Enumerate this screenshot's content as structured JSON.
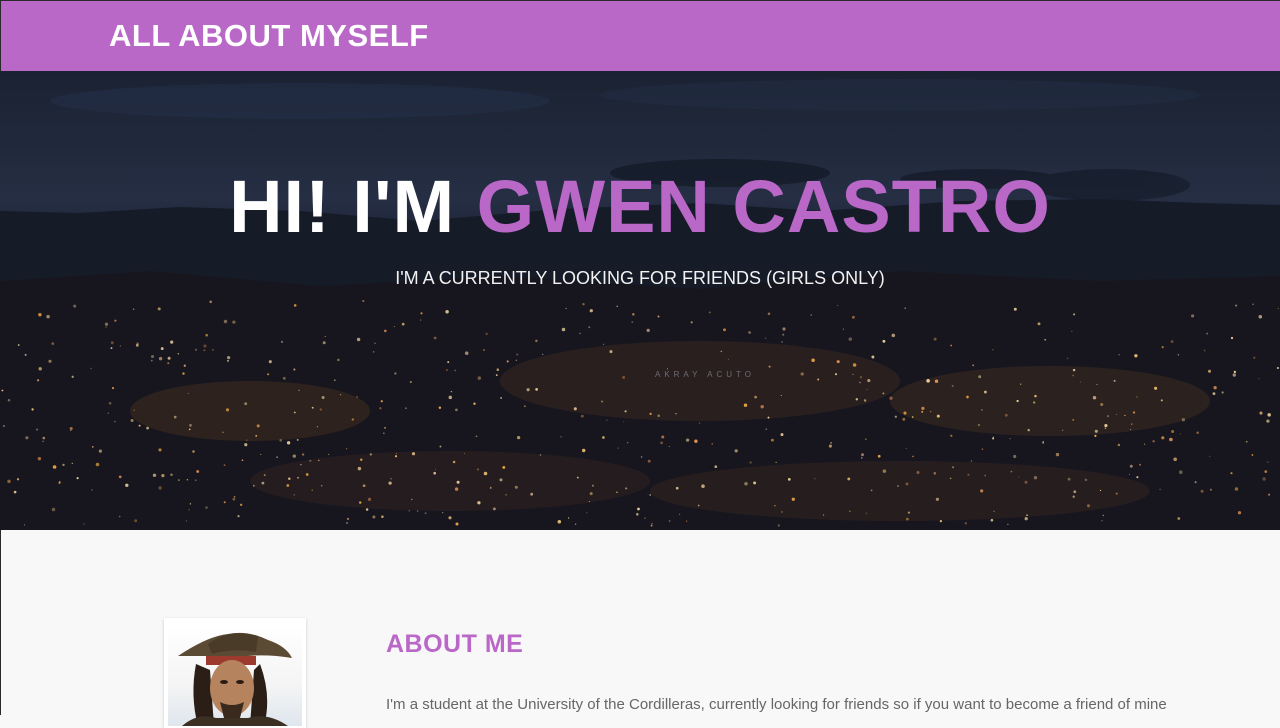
{
  "navbar": {
    "brand": "ALL ABOUT MYSELF"
  },
  "hero": {
    "greeting": "HI! I'M ",
    "name": "GWEN CASTRO",
    "subtitle": "I'M A CURRENTLY LOOKING FOR FRIENDS (GIRLS ONLY)",
    "watermark": "AKRAY ACUTO"
  },
  "about": {
    "title": "ABOUT ME",
    "text": "I'm a student at the University of the Cordilleras, currently looking for friends so if you want to become a friend of mine"
  },
  "colors": {
    "accent": "#b968c7",
    "hero_text": "#ffffff",
    "body_text": "#666666"
  }
}
